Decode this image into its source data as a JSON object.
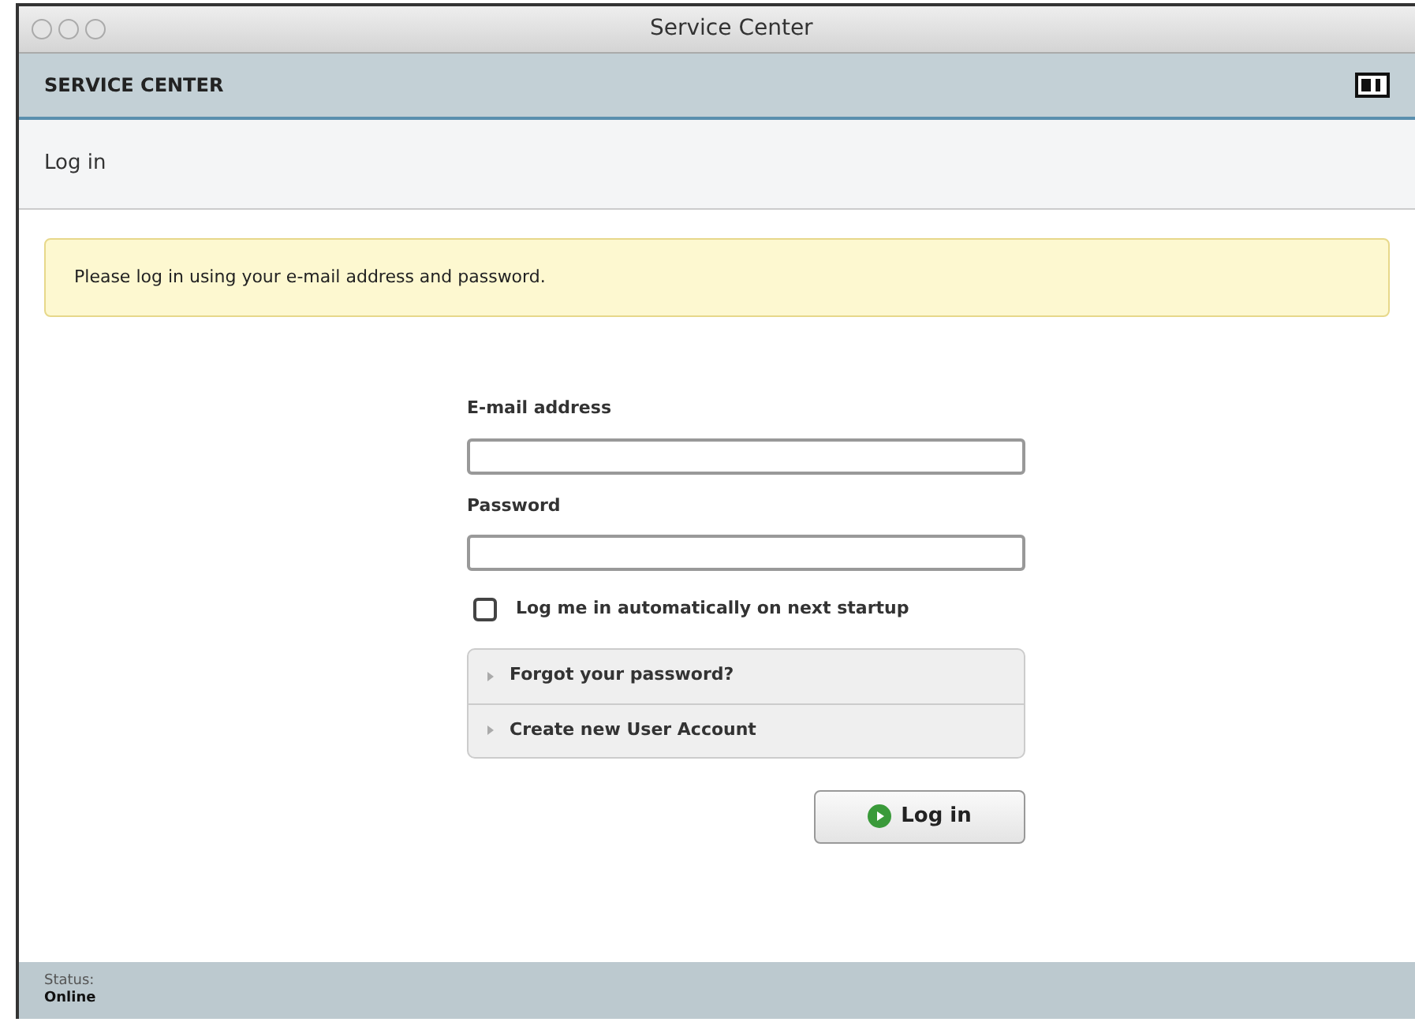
{
  "window": {
    "title": "Service Center"
  },
  "header": {
    "title": "SERVICE CENTER"
  },
  "page": {
    "title": "Log in"
  },
  "notice": "Please log in using your e-mail address and password.",
  "form": {
    "email_label": "E-mail address",
    "password_label": "Password",
    "auto_login": {
      "label": "Log me in automatically on next startup",
      "checked": false
    },
    "links": [
      {
        "label": "Forgot your password?"
      },
      {
        "label": "Create new User Account"
      }
    ],
    "submit": "Log in"
  },
  "status_bar": {
    "label": "Status:",
    "value": "Online"
  }
}
